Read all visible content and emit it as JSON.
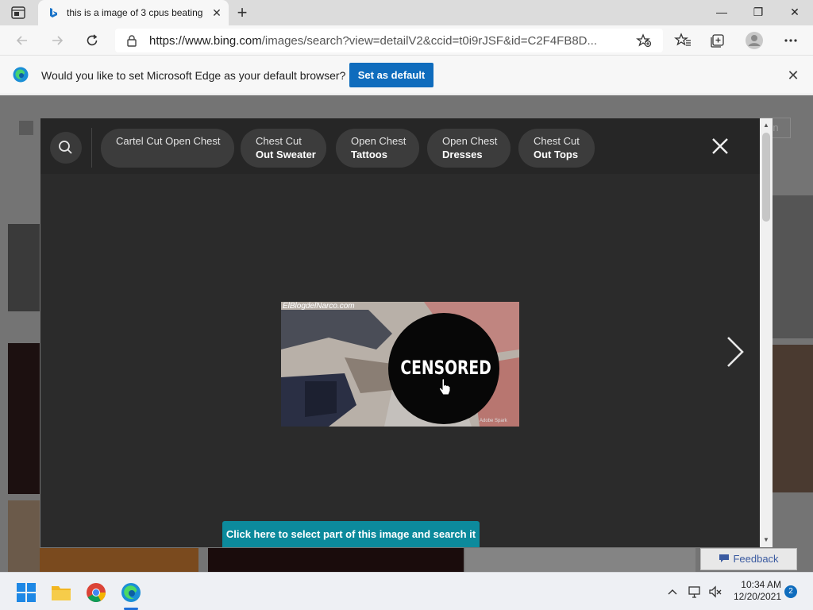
{
  "browser": {
    "tab_title": "this is a image of 3 cpus beating",
    "tab_close": "✕",
    "new_tab": "+",
    "minimize": "—",
    "maximize": "❐",
    "close": "✕",
    "url_host": "https://www.bing.com",
    "url_path": "/images/search?view=detailV2&ccid=t0i9rJSF&id=C2F4FB8D..."
  },
  "banner": {
    "message": "Would you like to set Microsoft Edge as your default browser?",
    "button_label": "Set as default",
    "close": "✕"
  },
  "viewer": {
    "related_searches": [
      {
        "line1": "Cartel Cut Open Chest",
        "line2": ""
      },
      {
        "line1": "Chest Cut",
        "line2": "Out Sweater"
      },
      {
        "line1": "Open Chest",
        "line2": "Tattoos"
      },
      {
        "line1": "Open Chest",
        "line2": "Dresses"
      },
      {
        "line1": "Chest Cut",
        "line2": "Out Tops"
      }
    ],
    "image_watermark": "ElBlogdelNarco.com",
    "censored_label": "CENSORED",
    "image_credit": "Adobe Spark",
    "visual_search_label": "Click here to select part of this image and search it"
  },
  "page": {
    "feedback_label": "Feedback",
    "partial_button": "n"
  },
  "taskbar": {
    "time": "10:34 AM",
    "date": "12/20/2021",
    "notification_count": "2"
  },
  "colors": {
    "accent": "#0f6cbd",
    "visual_search": "#0c8a9c",
    "viewer_bg": "#2b2b2b"
  }
}
